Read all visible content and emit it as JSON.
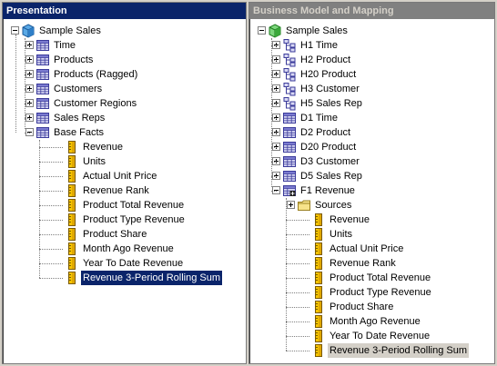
{
  "left_pane": {
    "title": "Presentation",
    "root": {
      "label": "Sample Sales",
      "icon": "catalog-cube-icon"
    },
    "tables": [
      {
        "label": "Time",
        "icon": "table-icon"
      },
      {
        "label": "Products",
        "icon": "table-icon"
      },
      {
        "label": "Products (Ragged)",
        "icon": "table-icon"
      },
      {
        "label": "Customers",
        "icon": "table-icon"
      },
      {
        "label": "Customer Regions",
        "icon": "table-icon"
      },
      {
        "label": "Sales Reps",
        "icon": "table-icon"
      },
      {
        "label": "Base Facts",
        "icon": "table-icon"
      }
    ],
    "columns": [
      {
        "label": "Revenue",
        "icon": "measure-column-icon"
      },
      {
        "label": "Units",
        "icon": "measure-column-icon"
      },
      {
        "label": "Actual Unit Price",
        "icon": "measure-column-icon"
      },
      {
        "label": "Revenue Rank",
        "icon": "measure-column-icon"
      },
      {
        "label": "Product Total Revenue",
        "icon": "measure-column-icon"
      },
      {
        "label": "Product Type Revenue",
        "icon": "measure-column-icon"
      },
      {
        "label": "Product Share",
        "icon": "measure-column-icon"
      },
      {
        "label": "Month Ago Revenue",
        "icon": "measure-column-icon"
      },
      {
        "label": "Year To Date Revenue",
        "icon": "measure-column-icon"
      },
      {
        "label": "Revenue 3-Period Rolling Sum",
        "icon": "measure-column-icon",
        "selected": true
      }
    ]
  },
  "right_pane": {
    "title": "Business Model and Mapping",
    "root": {
      "label": "Sample Sales",
      "icon": "business-model-cube-icon"
    },
    "hierarchies": [
      {
        "label": "H1 Time",
        "icon": "hierarchy-icon"
      },
      {
        "label": "H2 Product",
        "icon": "hierarchy-icon"
      },
      {
        "label": "H20 Product",
        "icon": "hierarchy-icon"
      },
      {
        "label": "H3 Customer",
        "icon": "hierarchy-icon"
      },
      {
        "label": "H5 Sales Rep",
        "icon": "hierarchy-icon"
      }
    ],
    "dimensions": [
      {
        "label": "D1 Time",
        "icon": "table-icon"
      },
      {
        "label": "D2 Product",
        "icon": "table-icon"
      },
      {
        "label": "D20 Product",
        "icon": "table-icon"
      },
      {
        "label": "D3 Customer",
        "icon": "table-icon"
      },
      {
        "label": "D5 Sales Rep",
        "icon": "table-icon"
      }
    ],
    "fact": {
      "label": "F1 Revenue",
      "icon": "fact-table-icon"
    },
    "sources": {
      "label": "Sources",
      "icon": "folder-icon"
    },
    "columns": [
      {
        "label": "Revenue",
        "icon": "measure-column-icon"
      },
      {
        "label": "Units",
        "icon": "measure-column-icon"
      },
      {
        "label": "Actual Unit Price",
        "icon": "measure-column-icon"
      },
      {
        "label": "Revenue Rank",
        "icon": "measure-column-icon"
      },
      {
        "label": "Product Total Revenue",
        "icon": "measure-column-icon"
      },
      {
        "label": "Product Type Revenue",
        "icon": "measure-column-icon"
      },
      {
        "label": "Product Share",
        "icon": "measure-column-icon"
      },
      {
        "label": "Month Ago Revenue",
        "icon": "measure-column-icon"
      },
      {
        "label": "Year To Date Revenue",
        "icon": "measure-column-icon"
      },
      {
        "label": "Revenue 3-Period Rolling Sum",
        "icon": "measure-column-icon",
        "selected": true
      }
    ]
  },
  "colors": {
    "active_title_bg": "#0a246a",
    "inactive_title_bg": "#808080",
    "selection_active": "#0a246a",
    "selection_inactive": "#d4d0c8"
  }
}
